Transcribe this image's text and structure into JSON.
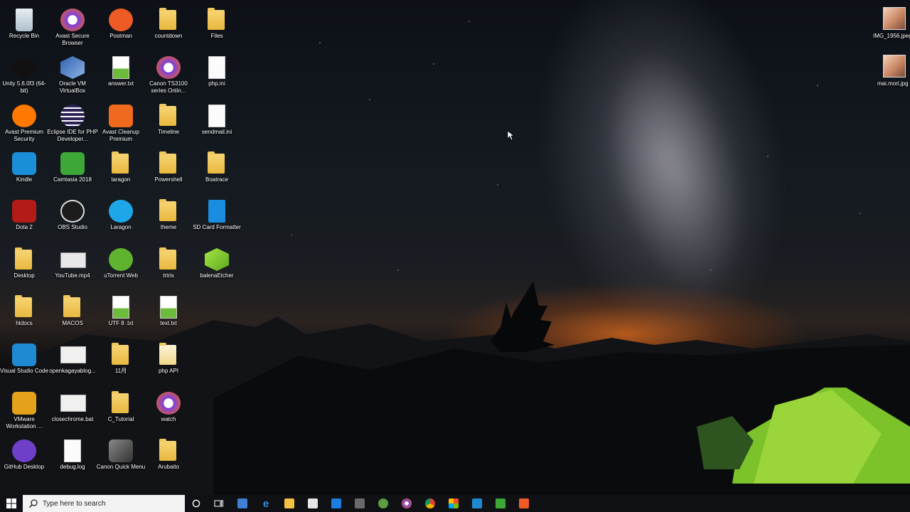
{
  "desktop": {
    "col1": [
      {
        "label": "Recycle Bin",
        "icon": "recycle-bin-icon"
      },
      {
        "label": "Unity 5.6.0f3 (64-bit)",
        "icon": "unity-icon"
      },
      {
        "label": "Avast Premium Security",
        "icon": "avast-icon"
      },
      {
        "label": "Kindle",
        "icon": "kindle-icon"
      },
      {
        "label": "Dota 2",
        "icon": "dota-icon"
      },
      {
        "label": "Desktop",
        "icon": "folder-icon"
      },
      {
        "label": "htdocs",
        "icon": "folder-icon"
      },
      {
        "label": "Visual Studio Code",
        "icon": "vscode-icon"
      },
      {
        "label": "VMware Workstation ...",
        "icon": "vmware-icon"
      },
      {
        "label": "GitHub Desktop",
        "icon": "github-icon"
      }
    ],
    "col2": [
      {
        "label": "Avast Secure Browser",
        "icon": "avast-browser-icon"
      },
      {
        "label": "Oracle VM VirtualBox",
        "icon": "virtualbox-icon"
      },
      {
        "label": "Eclipse IDE for PHP Developer...",
        "icon": "eclipse-icon"
      },
      {
        "label": "Camtasia 2018",
        "icon": "camtasia-icon"
      },
      {
        "label": "OBS Studio",
        "icon": "obs-icon"
      },
      {
        "label": "YouTube.mp4",
        "icon": "video-file-icon"
      },
      {
        "label": "MACOS",
        "icon": "folder-icon"
      },
      {
        "label": "openkagayablog...",
        "icon": "bat-file-icon"
      },
      {
        "label": "closechrome.bat",
        "icon": "bat-file-icon"
      },
      {
        "label": "debug.log",
        "icon": "file-icon"
      }
    ],
    "col3": [
      {
        "label": "Postman",
        "icon": "postman-icon"
      },
      {
        "label": "answer.txt",
        "icon": "text-file-icon"
      },
      {
        "label": "Avast Cleanup Premium",
        "icon": "avast-cleanup-icon"
      },
      {
        "label": "laragon",
        "icon": "folder-icon"
      },
      {
        "label": "Laragon",
        "icon": "laragon-icon"
      },
      {
        "label": "uTorrent Web",
        "icon": "utorrent-icon"
      },
      {
        "label": "UTF 8 .txt",
        "icon": "text-file-icon"
      },
      {
        "label": "11月",
        "icon": "folder-icon"
      },
      {
        "label": "C_Tutorial",
        "icon": "folder-icon"
      },
      {
        "label": "Canon Quick Menu",
        "icon": "canon-icon"
      }
    ],
    "col4": [
      {
        "label": "countdown",
        "icon": "folder-icon"
      },
      {
        "label": "Canon TS3100 series Onlin...",
        "icon": "canon-online-icon"
      },
      {
        "label": "Timeline",
        "icon": "folder-icon"
      },
      {
        "label": "Powershell",
        "icon": "folder-icon"
      },
      {
        "label": "theme",
        "icon": "folder-icon"
      },
      {
        "label": "trtris",
        "icon": "folder-icon"
      },
      {
        "label": "text.txt",
        "icon": "text-file-icon"
      },
      {
        "label": "php API",
        "icon": "folder-icon"
      },
      {
        "label": "watch",
        "icon": "watch-icon"
      },
      {
        "label": "Arubaito",
        "icon": "folder-icon"
      }
    ],
    "col5": [
      {
        "label": "Files",
        "icon": "folder-icon"
      },
      {
        "label": "php.ini",
        "icon": "config-file-icon"
      },
      {
        "label": "sendmail.ini",
        "icon": "config-file-icon"
      },
      {
        "label": "Boatrace",
        "icon": "folder-icon"
      },
      {
        "label": "SD Card Formatter",
        "icon": "sd-card-icon"
      },
      {
        "label": "balenaEtcher",
        "icon": "etcher-icon"
      }
    ],
    "right": [
      {
        "label": "IMG_1956.jpeg",
        "icon": "image-file-icon"
      },
      {
        "label": "mai.mori.jpg",
        "icon": "image-file-icon"
      }
    ]
  },
  "taskbar": {
    "search_placeholder": "Type here to search",
    "apps": [
      "cortana-icon",
      "task-view-icon",
      "people-icon",
      "edge-icon",
      "file-explorer-icon",
      "store-icon",
      "mail-icon",
      "snipping-icon",
      "android-studio-icon",
      "avast-browser-icon",
      "chrome-icon",
      "office-icon",
      "vscode-icon",
      "camtasia-icon",
      "postman-icon"
    ]
  },
  "colors": {
    "taskbar": "#101114",
    "accent": "#0078d7"
  }
}
